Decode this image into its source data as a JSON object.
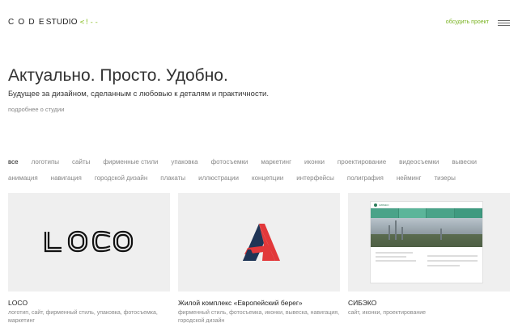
{
  "header": {
    "logo_word1": "CODE",
    "logo_word2": "STUDIO",
    "logo_tag": "<!--",
    "discuss_label": "обсудить проект"
  },
  "hero": {
    "title": "Актуально. Просто. Удобно.",
    "subtitle": "Будущее за дизайном, сделанным с любовью к деталям и практичности.",
    "about_link": "подробнее о студии"
  },
  "filters": {
    "row1": [
      "все",
      "логотипы",
      "сайты",
      "фирменные стили",
      "упаковка",
      "фотосъемки",
      "маркетинг",
      "иконки",
      "проектирование",
      "видеосъемки",
      "вывески"
    ],
    "row2": [
      "анимация",
      "навигация",
      "городской дизайн",
      "плакаты",
      "иллюстрации",
      "концепции",
      "интерфейсы",
      "полиграфия",
      "нейминг",
      "тизеры"
    ],
    "active": "все"
  },
  "cards": [
    {
      "title": "LOCO",
      "tags": "логотип, сайт, фирменный стиль, упаковка, фотосъемка, маркетинг",
      "thumb_text": "LOCO"
    },
    {
      "title": "Жилой комплекс «Европейский берег»",
      "tags": "фирменный стиль, фотосъемка, иконки, вывеска, навигация, городской дизайн"
    },
    {
      "title": "СИБЭКО",
      "tags": "сайт, иконки, проектирование"
    }
  ],
  "colors": {
    "accent": "#7ab322",
    "logo_red": "#e2383a",
    "logo_navy": "#1f3556",
    "site_green": "#4aa389"
  }
}
